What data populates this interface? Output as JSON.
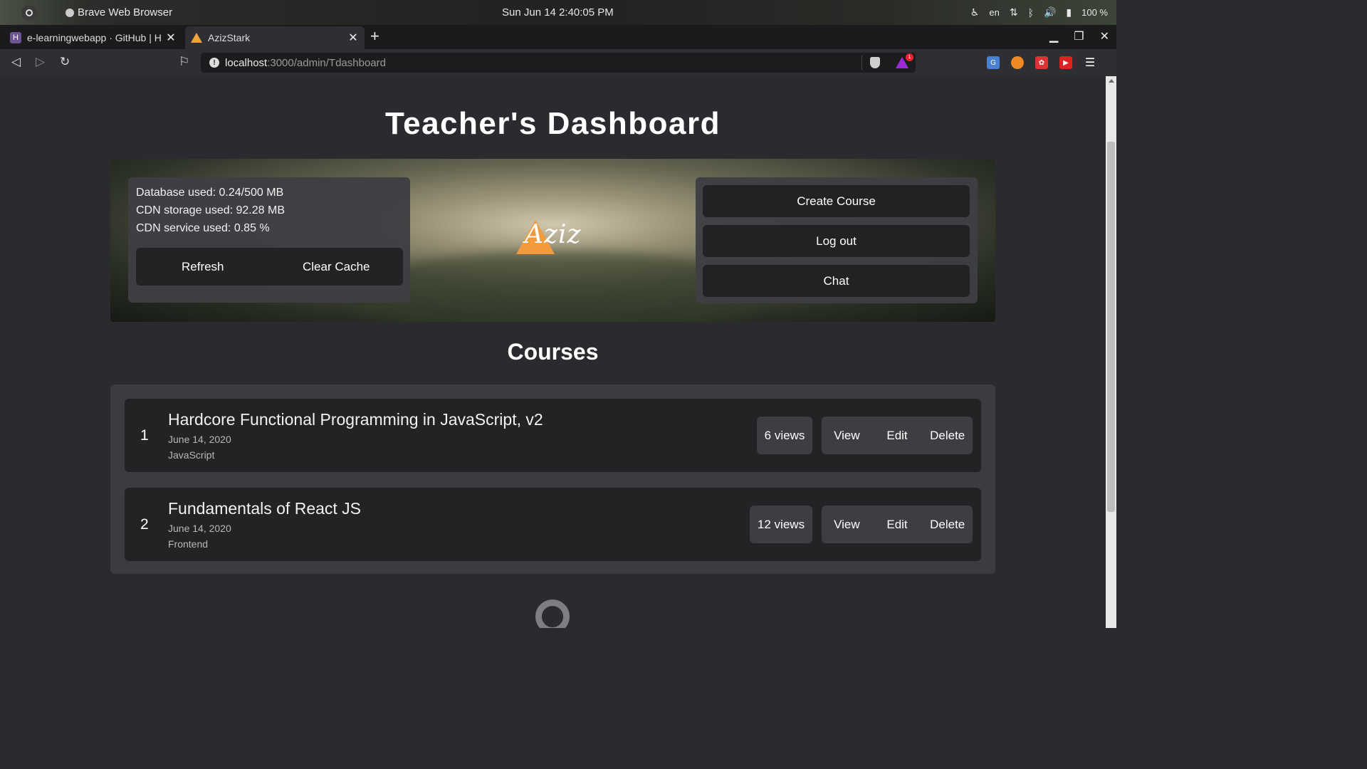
{
  "system": {
    "app_name": "Brave Web Browser",
    "clock": "Sun Jun 14   2:40:05 PM",
    "language": "en",
    "battery": "100 %"
  },
  "browser": {
    "tabs": [
      {
        "title": "e-learningwebapp · GitHub | H",
        "active": false
      },
      {
        "title": "AzizStark",
        "active": true
      }
    ],
    "url_host": "localhost",
    "url_path": ":3000/admin/Tdashboard",
    "shields_badge": "1"
  },
  "page": {
    "title": "Teacher's Dashboard",
    "stats": {
      "database": "Database used: 0.24/500 MB",
      "cdn_storage": "CDN storage used: 92.28 MB",
      "cdn_service": "CDN service used: 0.85 %",
      "refresh_label": "Refresh",
      "clear_cache_label": "Clear Cache"
    },
    "logo_text": "Aziz",
    "actions": {
      "create_course": "Create Course",
      "logout": "Log out",
      "chat": "Chat"
    },
    "courses_heading": "Courses",
    "courses": [
      {
        "index": "1",
        "title": "Hardcore Functional Programming in JavaScript, v2",
        "date": "June 14, 2020",
        "category": "JavaScript",
        "views": "6 views",
        "view": "View",
        "edit": "Edit",
        "delete": "Delete"
      },
      {
        "index": "2",
        "title": "Fundamentals of React JS",
        "date": "June 14, 2020",
        "category": "Frontend",
        "views": "12 views",
        "view": "View",
        "edit": "Edit",
        "delete": "Delete"
      }
    ]
  },
  "colors": {
    "page_bg": "#2b2b2f",
    "card_bg": "#232326",
    "panel_bg": "#3b3b40",
    "logo_orange": "#f39a3c"
  }
}
